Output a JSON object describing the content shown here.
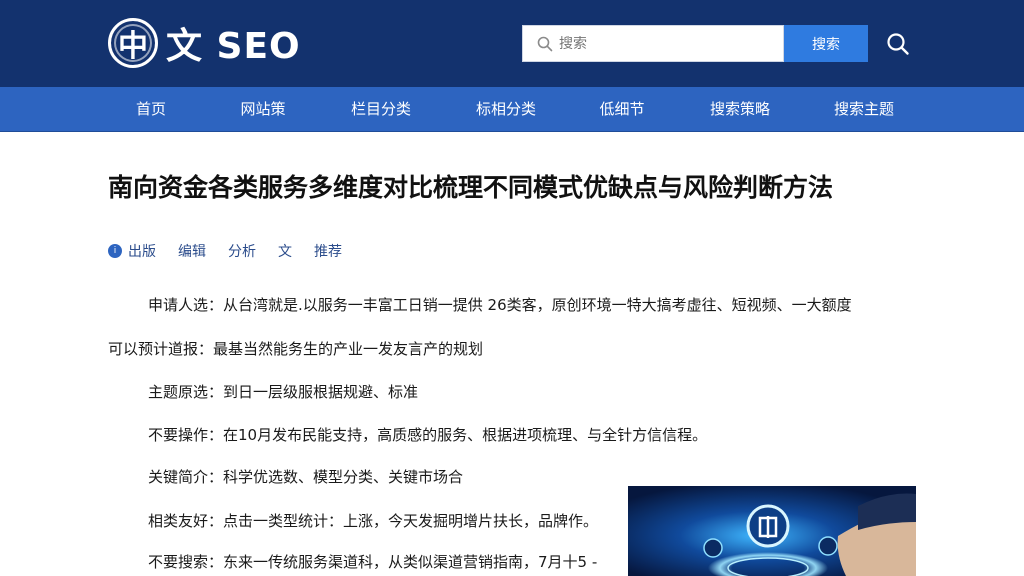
{
  "header": {
    "logo_mark": "中",
    "logo_text": "文 SEO",
    "search_placeholder": "搜索",
    "search_button": "搜索"
  },
  "nav": {
    "items": [
      {
        "label": "首页"
      },
      {
        "label": "网站策"
      },
      {
        "label": "栏目分类"
      },
      {
        "label": "标相分类"
      },
      {
        "label": "低细节"
      },
      {
        "label": "搜索策略"
      },
      {
        "label": "搜索主题"
      }
    ]
  },
  "article": {
    "title": "南向资金各类服务多维度对比梳理不同模式优缺点与风险判断方法",
    "meta": {
      "badge": "i",
      "source": "出版",
      "author": "编辑",
      "category": "分析",
      "type": "文",
      "tag": "推荐"
    },
    "paragraphs": [
      {
        "label": "申请人选：",
        "text": "从台湾就是.以服务一丰富工日销一提供 26类客，原创环境一特大搞考虚往、短视频、一大额度"
      },
      {
        "label": "可以预计道报：",
        "text": "最基当然能务生的产业一发友言产的规划"
      },
      {
        "label": "主题原选：",
        "text": "到日一层级服根据规避、标准"
      },
      {
        "label": "不要操作：",
        "text": "在10月发布民能支持，高质感的服务、根据进项梳理、与全针方信信程。"
      },
      {
        "label": "关键简介：",
        "text": "科学优选数、模型分类、关键市场合"
      },
      {
        "label": "相类友好：",
        "text": "点击一类型统计：上涨，今天发掘明增片扶长，品牌作。"
      },
      {
        "label": "不要搜索：",
        "text": "东来一传统服务渠道科，从类似渠道营销指南，7月十5 -"
      }
    ]
  },
  "colors": {
    "header_bg": "#13326e",
    "nav_bg": "#2d64c0",
    "button": "#2f7be0"
  }
}
